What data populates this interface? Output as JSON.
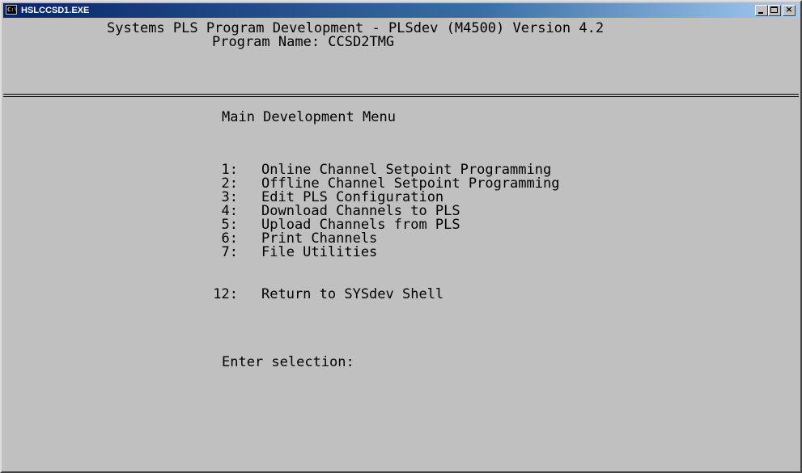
{
  "window": {
    "title": "HSLCCSD1.EXE",
    "icon": "console-app-icon",
    "controls": [
      "minimize-icon",
      "maximize-icon",
      "close-icon"
    ]
  },
  "header": {
    "title": "Systems PLS Program Development - PLSdev (M4500) Version 4.2",
    "program_label": "Program Name: CCSD2TMG"
  },
  "menu": {
    "heading": "Main Development Menu",
    "items": [
      {
        "number": "1:",
        "label": "Online Channel Setpoint Programming"
      },
      {
        "number": "2:",
        "label": "Offline Channel Setpoint Programming"
      },
      {
        "number": "3:",
        "label": "Edit PLS Configuration"
      },
      {
        "number": "4:",
        "label": "Download Channels to PLS"
      },
      {
        "number": "5:",
        "label": "Upload Channels from PLS"
      },
      {
        "number": "6:",
        "label": "Print Channels"
      },
      {
        "number": "7:",
        "label": "File Utilities"
      }
    ],
    "return_item": {
      "number": "12:",
      "label": "Return to SYSdev Shell"
    },
    "prompt": "Enter selection:"
  },
  "colors": {
    "background": "#c0c0c0",
    "text": "#000000",
    "titlebar": "#0a246a"
  }
}
